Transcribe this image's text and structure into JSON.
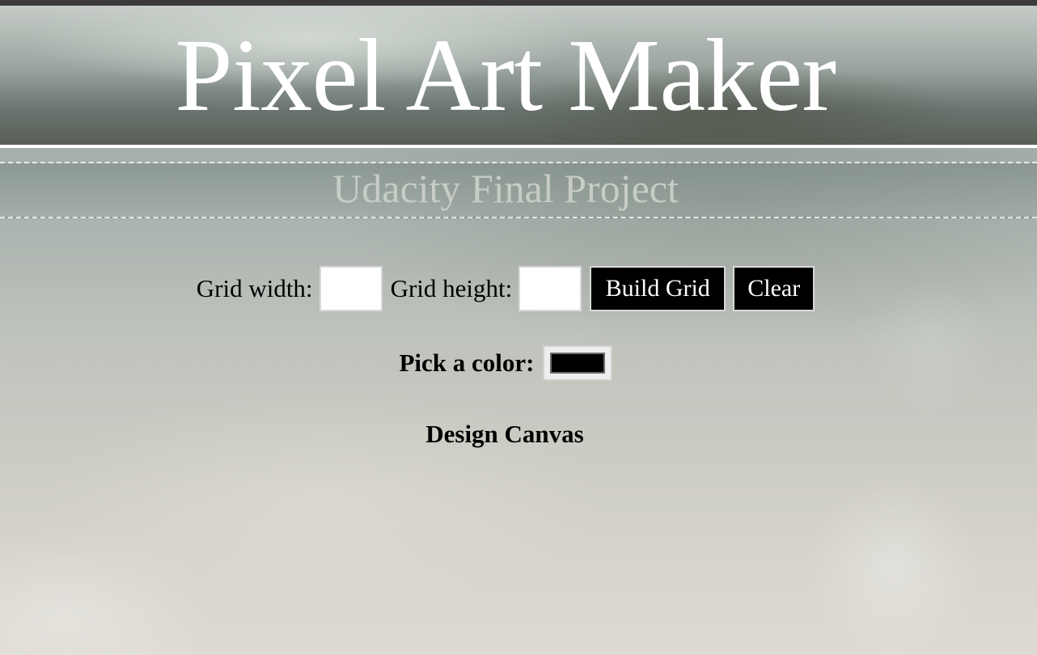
{
  "header": {
    "title": "Pixel Art Maker",
    "subtitle": "Udacity Final Project"
  },
  "size_form": {
    "width_label": "Grid width:",
    "width_value": "",
    "height_label": "Grid height:",
    "height_value": "",
    "build_button_label": "Build Grid",
    "clear_button_label": "Clear"
  },
  "color_picker": {
    "label": "Pick a color:",
    "value": "#000000"
  },
  "canvas": {
    "heading": "Design Canvas"
  },
  "colors": {
    "button_bg": "#000000",
    "button_text": "#ffffff",
    "title_text": "#ffffff",
    "subtitle_text": "#c8ccc6"
  }
}
